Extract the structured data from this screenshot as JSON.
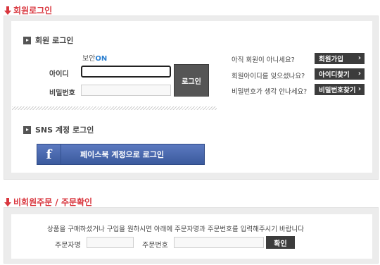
{
  "member_section": {
    "title": "회원로그인",
    "subhead": "회원 로그인",
    "security_label": "보안",
    "security_state": "ON",
    "id_label": "아이디",
    "pw_label": "비밀번호",
    "id_value": "",
    "pw_value": "",
    "login_button": "로그인",
    "questions": [
      {
        "text": "아직 회원이 아니세요?",
        "button": "회원가입"
      },
      {
        "text": "회원아이디를 잊으셨나요?",
        "button": "아이디찾기"
      },
      {
        "text": "비밀번호가 생각 안나세요?",
        "button": "비밀번호찾기"
      }
    ],
    "sns_subhead": "SNS 계정 로그인",
    "facebook_letter": "f",
    "facebook_button": "페이스북 계정으로 로그인"
  },
  "guest_section": {
    "title": "비회원주문 / 주문확인",
    "description": "상품을 구매하셨거나 구입을 원하시면 아래에 주문자명과 주문번호를 입력해주시기 바랍니다",
    "name_label": "주문자명",
    "number_label": "주문번호",
    "name_value": "",
    "number_value": "",
    "confirm_button": "확인"
  }
}
